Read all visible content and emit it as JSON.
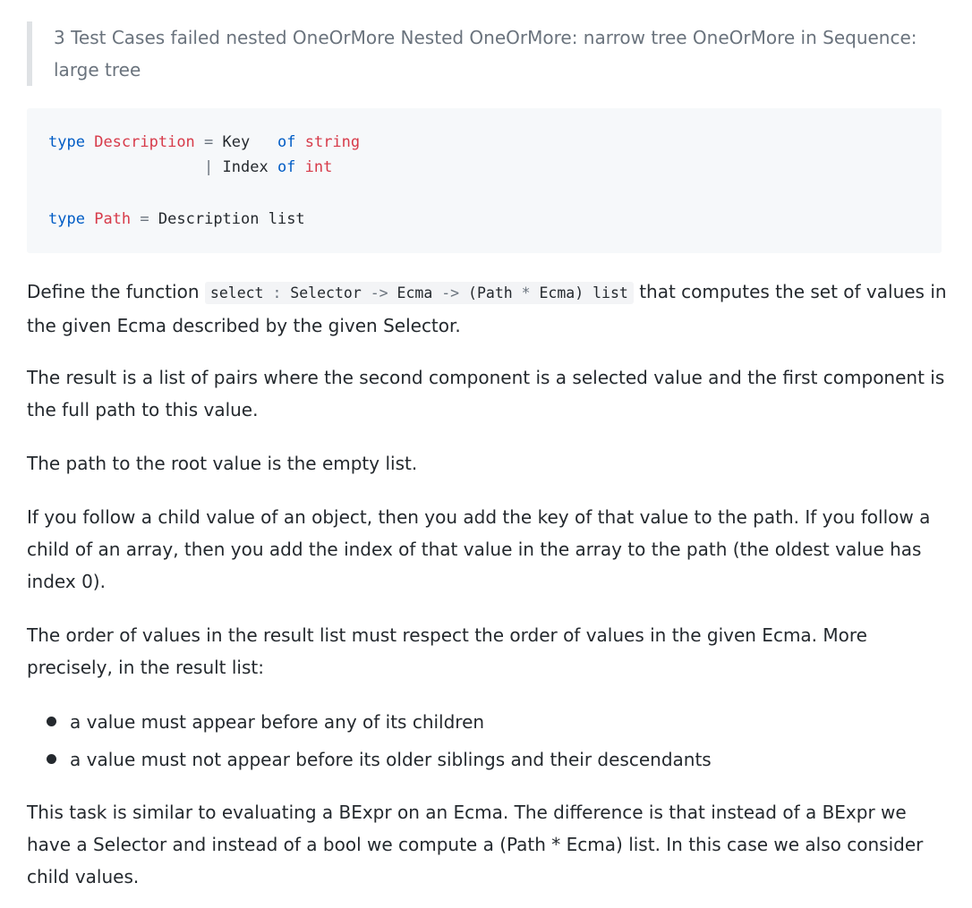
{
  "blockquote": {
    "text": "3 Test Cases failed nested OneOrMore Nested OneOrMore: narrow tree OneOrMore in Sequence: large tree"
  },
  "code": {
    "line1": {
      "kw_type": "type",
      "name": "Description",
      "eq": "=",
      "ctor": "Key",
      "kw_of": "of",
      "arg": "string"
    },
    "line2": {
      "bar": "|",
      "ctor": "Index",
      "kw_of": "of",
      "arg": "int"
    },
    "line3": {
      "kw_type": "type",
      "name": "Path",
      "eq": "=",
      "rest": "Description list"
    }
  },
  "para1": {
    "before": "Define the function ",
    "code_a": "select ",
    "code_colon": ":",
    "code_b": " Selector ",
    "code_arrow1": "->",
    "code_c": " Ecma ",
    "code_arrow2": "->",
    "code_d": " (Path ",
    "code_star": "*",
    "code_e": " Ecma) list",
    "after": " that computes the set of values in the given Ecma described by the given Selector."
  },
  "para2": "The result is a list of pairs where the second component is a selected value and the first component is the full path to this value.",
  "para3": "The path to the root value is the empty list.",
  "para4": "If you follow a child value of an object, then you add the key of that value to the path. If you follow a child of an array, then you add the index of that value in the array to the path (the oldest value has index 0).",
  "para5": "The order of values in the result list must respect the order of values in the given Ecma. More precisely, in the result list:",
  "bullets": [
    "a value must appear before any of its children",
    "a value must not appear before its older siblings and their descendants"
  ],
  "para6": "This task is similar to evaluating a BExpr on an Ecma. The difference is that instead of a BExpr we have a Selector and instead of a bool we compute a (Path * Ecma) list. In this case we also consider child values."
}
